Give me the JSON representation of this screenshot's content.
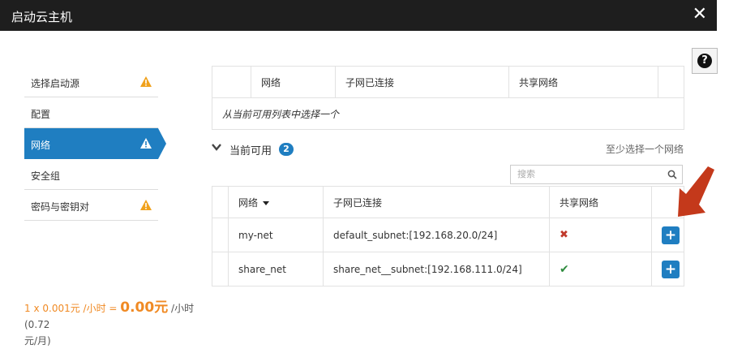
{
  "dialog": {
    "title": "启动云主机",
    "close_glyph": "✕",
    "help_glyph": "?"
  },
  "sidebar": {
    "items": [
      {
        "label": "选择启动源",
        "warning": true,
        "active": false
      },
      {
        "label": "配置",
        "warning": false,
        "active": false
      },
      {
        "label": "网络",
        "warning": true,
        "active": true
      },
      {
        "label": "安全组",
        "warning": false,
        "active": false
      },
      {
        "label": "密码与密钥对",
        "warning": true,
        "active": false
      }
    ]
  },
  "allocated": {
    "columns": [
      "",
      "网络",
      "子网已连接",
      "共享网络",
      ""
    ],
    "empty_text": "从当前可用列表中选择一个"
  },
  "available": {
    "title": "当前可用",
    "count": "2",
    "hint": "至少选择一个网络",
    "search_placeholder": "搜索",
    "columns": [
      "网络",
      "子网已连接",
      "共享网络"
    ],
    "rows": [
      {
        "network": "my-net",
        "subnet": "default_subnet:[192.168.20.0/24]",
        "shared": false
      },
      {
        "network": "share_net",
        "subnet": "share_net__subnet:[192.168.111.0/24]",
        "shared": true
      }
    ],
    "add_glyph": "+",
    "shared_yes_glyph": "✔",
    "shared_no_glyph": "✖"
  },
  "price": {
    "formula": "1 x 0.001元 /小时 = ",
    "total": "0.00元",
    "unit": " /小时 (0.72",
    "monthly": "元/月)"
  },
  "colors": {
    "accent": "#1f7ec1",
    "warning": "#f0a11c",
    "arrow": "#c4391b",
    "price": "#f08a24"
  }
}
